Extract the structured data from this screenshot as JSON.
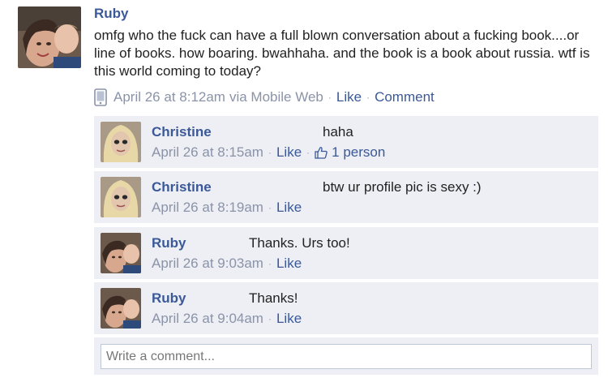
{
  "post": {
    "author": "Ruby",
    "text": "omfg who the fuck can have a full blown conversation about a fucking book....or line of books. how boaring. bwahhaha. and the book is a book about russia. wtf is this world coming to today?",
    "timestamp": "April 26 at 8:12am",
    "via": "via Mobile Web",
    "like_label": "Like",
    "comment_label": "Comment",
    "meta_icon": "mobile-phone-icon"
  },
  "comments": [
    {
      "author": "Christine",
      "text": "haha",
      "timestamp": "April 26 at 8:15am",
      "like_label": "Like",
      "likes_count": "1 person"
    },
    {
      "author": "Christine",
      "text": "btw ur profile pic is sexy :)",
      "timestamp": "April 26 at 8:19am",
      "like_label": "Like"
    },
    {
      "author": "Ruby",
      "text": "Thanks. Urs too!",
      "timestamp": "April 26 at 9:03am",
      "like_label": "Like"
    },
    {
      "author": "Ruby",
      "text": "Thanks!",
      "timestamp": "April 26 at 9:04am",
      "like_label": "Like"
    }
  ],
  "composer": {
    "placeholder": "Write a comment..."
  },
  "colors": {
    "link": "#3b5998",
    "meta": "#8a93a8",
    "comment_bg": "#edeff4",
    "border": "#bdc7d8"
  }
}
